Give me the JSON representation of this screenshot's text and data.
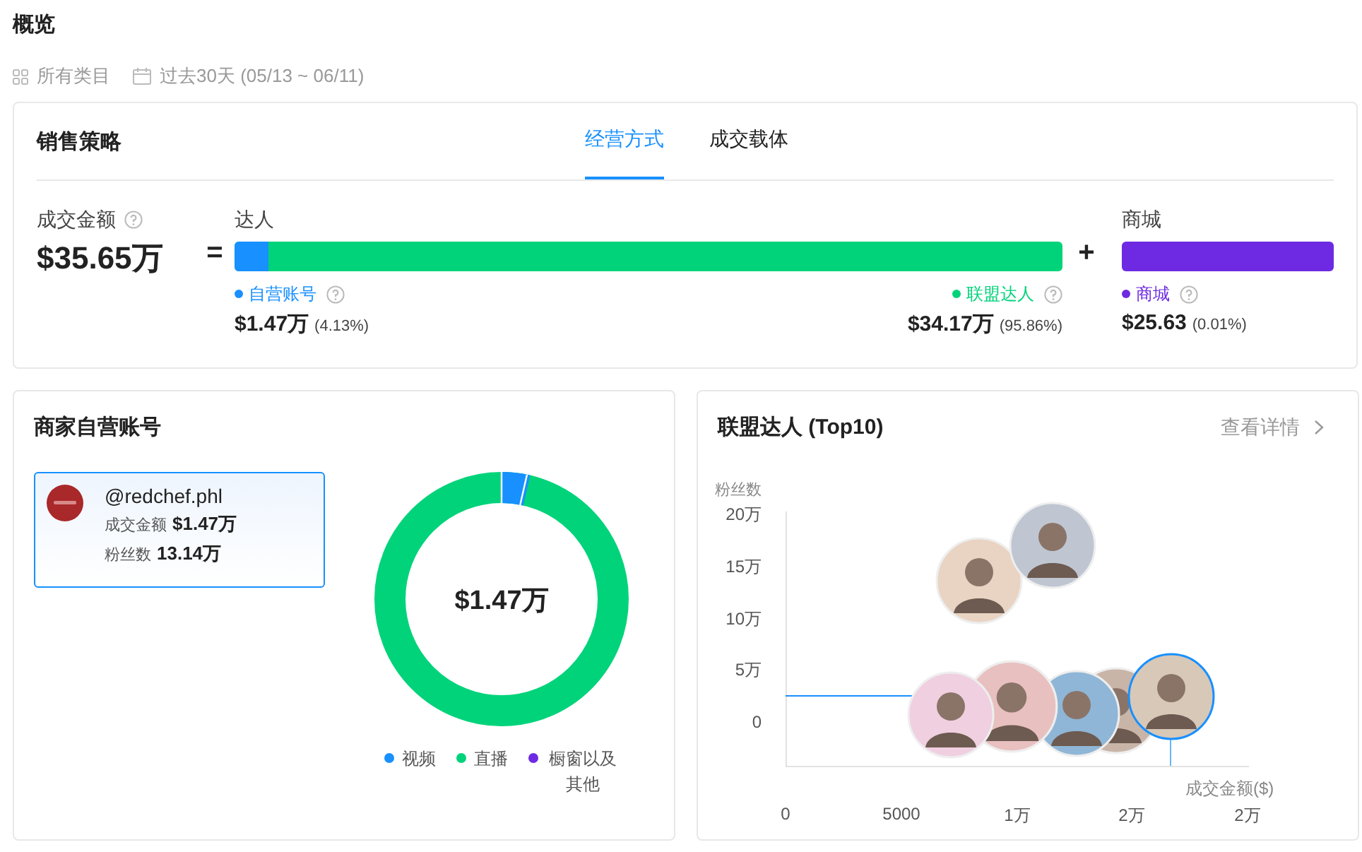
{
  "title": "概览",
  "filters": [
    {
      "kind": "category",
      "label": "所有类目"
    },
    {
      "kind": "date",
      "label": "过去30天 (05/13 ~ 06/11)"
    }
  ],
  "strategy": {
    "title": "销售策略",
    "tabs": [
      {
        "label": "经营方式",
        "selected": true
      },
      {
        "label": "成交载体",
        "selected": false
      }
    ],
    "total": {
      "label": "成交金额",
      "value": "$35.65万"
    },
    "equals": "=",
    "plus": "+",
    "creators": {
      "label": "达人",
      "level": 0.0413,
      "segments": [
        {
          "label": "自营账号",
          "value": "$1.47万",
          "share": "(4.13%)",
          "color": "#1890ff"
        },
        {
          "label": "联盟达人",
          "value": "$34.17万",
          "share": "(95.86%)",
          "color": "#00d37a"
        }
      ]
    },
    "mall": {
      "label": "商城",
      "color": "#6d2ae2",
      "segment": {
        "label": "商城",
        "value": "$25.63",
        "share": "(0.01%)"
      }
    }
  },
  "own_account": {
    "title": "商家自营账号",
    "account": {
      "handle": "@redchef.phl",
      "selected": true,
      "stats": [
        {
          "label": "成交金额",
          "value": "$1.47万"
        },
        {
          "label": "粉丝数",
          "value": "13.14万"
        }
      ]
    },
    "donut_center": "$1.47万",
    "legend": [
      {
        "label": "视频",
        "color": "#1890ff"
      },
      {
        "label": "直播",
        "color": "#00d37a"
      },
      {
        "label": "橱窗以及其他",
        "color": "#6d2ae2"
      }
    ]
  },
  "affiliates": {
    "title": "联盟达人 (Top10)",
    "details_link": "查看详情",
    "y_axis_label": "粉丝数",
    "y_ticks": [
      "20万",
      "15万",
      "10万",
      "5万",
      "0"
    ],
    "x_axis_label": "成交金额($)",
    "x_ticks": [
      "0",
      "5000",
      "1万",
      "2万",
      "2万"
    ]
  }
}
